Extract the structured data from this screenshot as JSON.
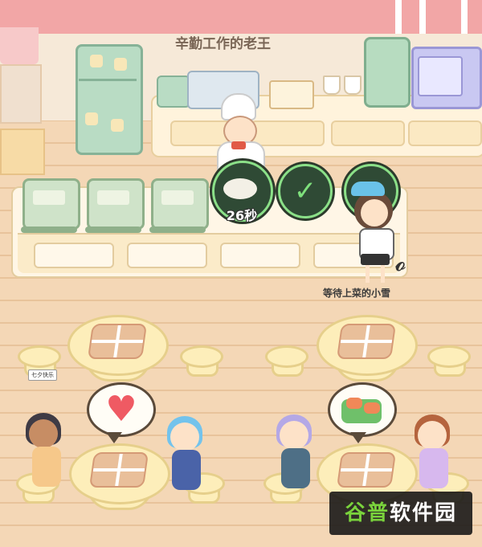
{
  "labels": {
    "chef_name": "辛勤工作的老王",
    "waitress_name": "等待上菜的小雪",
    "cook_timer": "26秒",
    "table_sign": "七夕快乐"
  },
  "watermark": {
    "part1": "谷普",
    "part2": "软件园"
  },
  "icons": {
    "done_indicator": "checkmark-icon",
    "customer_request_1": "heart-icon",
    "customer_request_2": "sushi-dish-icon"
  },
  "colors": {
    "timer_ring": "#8be088",
    "heart": "#ef5a63",
    "wall_top": "#f2a6a6"
  }
}
